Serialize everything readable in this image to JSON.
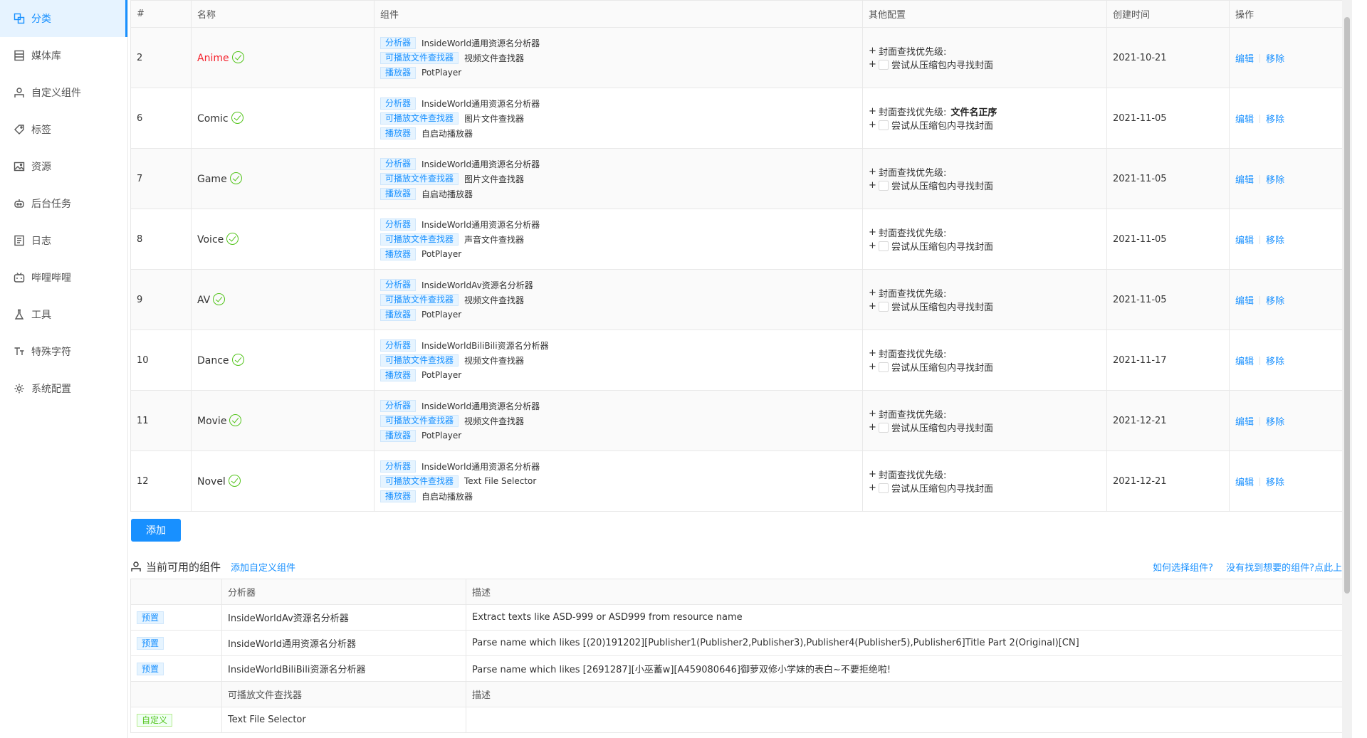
{
  "sidebar": {
    "items": [
      {
        "label": "分类",
        "icon": "category-icon",
        "active": true
      },
      {
        "label": "媒体库",
        "icon": "library-icon"
      },
      {
        "label": "自定义组件",
        "icon": "component-icon"
      },
      {
        "label": "标签",
        "icon": "tag-icon"
      },
      {
        "label": "资源",
        "icon": "image-icon"
      },
      {
        "label": "后台任务",
        "icon": "robot-icon"
      },
      {
        "label": "日志",
        "icon": "log-icon"
      },
      {
        "label": "哔哩哔哩",
        "icon": "bilibili-icon"
      },
      {
        "label": "工具",
        "icon": "tool-icon"
      },
      {
        "label": "特殊字符",
        "icon": "text-icon"
      },
      {
        "label": "系统配置",
        "icon": "gear-icon"
      }
    ]
  },
  "table": {
    "headers": [
      "#",
      "名称",
      "组件",
      "其他配置",
      "创建时间",
      "操作"
    ],
    "tag_labels": {
      "analyzer": "分析器",
      "finder": "可播放文件查找器",
      "player": "播放器"
    },
    "config_labels": {
      "cover_priority": "封面查找优先级:",
      "try_archive": "尝试从压缩包内寻找封面"
    },
    "op_labels": {
      "edit": "编辑",
      "remove": "移除"
    },
    "rows": [
      {
        "id": "2",
        "name": "Anime",
        "name_color": "#f5222d",
        "analyzer": "InsideWorld通用资源名分析器",
        "finder": "视频文件查找器",
        "player": "PotPlayer",
        "cover_value": "",
        "created": "2021-10-21"
      },
      {
        "id": "6",
        "name": "Comic",
        "name_color": "#333333",
        "analyzer": "InsideWorld通用资源名分析器",
        "finder": "图片文件查找器",
        "player": "自启动播放器",
        "cover_value": "文件名正序",
        "created": "2021-11-05"
      },
      {
        "id": "7",
        "name": "Game",
        "name_color": "#333333",
        "analyzer": "InsideWorld通用资源名分析器",
        "finder": "图片文件查找器",
        "player": "自启动播放器",
        "cover_value": "",
        "created": "2021-11-05"
      },
      {
        "id": "8",
        "name": "Voice",
        "name_color": "#333333",
        "analyzer": "InsideWorld通用资源名分析器",
        "finder": "声音文件查找器",
        "player": "PotPlayer",
        "cover_value": "",
        "created": "2021-11-05"
      },
      {
        "id": "9",
        "name": "AV",
        "name_color": "#333333",
        "analyzer": "InsideWorldAv资源名分析器",
        "finder": "视频文件查找器",
        "player": "PotPlayer",
        "cover_value": "",
        "created": "2021-11-05"
      },
      {
        "id": "10",
        "name": "Dance",
        "name_color": "#333333",
        "analyzer": "InsideWorldBiliBili资源名分析器",
        "finder": "视频文件查找器",
        "player": "PotPlayer",
        "cover_value": "",
        "created": "2021-11-17"
      },
      {
        "id": "11",
        "name": "Movie",
        "name_color": "#333333",
        "analyzer": "InsideWorld通用资源名分析器",
        "finder": "视频文件查找器",
        "player": "PotPlayer",
        "cover_value": "",
        "created": "2021-12-21"
      },
      {
        "id": "12",
        "name": "Novel",
        "name_color": "#333333",
        "analyzer": "InsideWorld通用资源名分析器",
        "finder": "Text File Selector",
        "player": "自启动播放器",
        "cover_value": "",
        "created": "2021-12-21"
      }
    ]
  },
  "add_button": "添加",
  "components": {
    "title": "当前可用的组件",
    "add_custom": "添加自定义组件",
    "help_link": "如何选择组件?",
    "report_link": "没有找到想要的组件?点此上报",
    "analyzer_header": "分析器",
    "desc_header": "描述",
    "finder_header": "可播放文件查找器",
    "analyzers": [
      {
        "tag": "预置",
        "name": "InsideWorldAv资源名分析器",
        "desc": "Extract texts like ASD-999 or ASD999 from resource name"
      },
      {
        "tag": "预置",
        "name": "InsideWorld通用资源名分析器",
        "desc": "Parse name which likes [(20)191202][Publisher1(Publisher2,Publisher3),Publisher4(Publisher5),Publisher6]Title Part 2(Original)[CN]"
      },
      {
        "tag": "预置",
        "name": "InsideWorldBiliBili资源名分析器",
        "desc": "Parse name which likes [2691287][小巫蓄w][A459080646]御萝双修小学妹的表白~不要拒绝啦!"
      }
    ],
    "finders": [
      {
        "tag": "自定义",
        "name": "Text File Selector",
        "desc": ""
      }
    ]
  }
}
